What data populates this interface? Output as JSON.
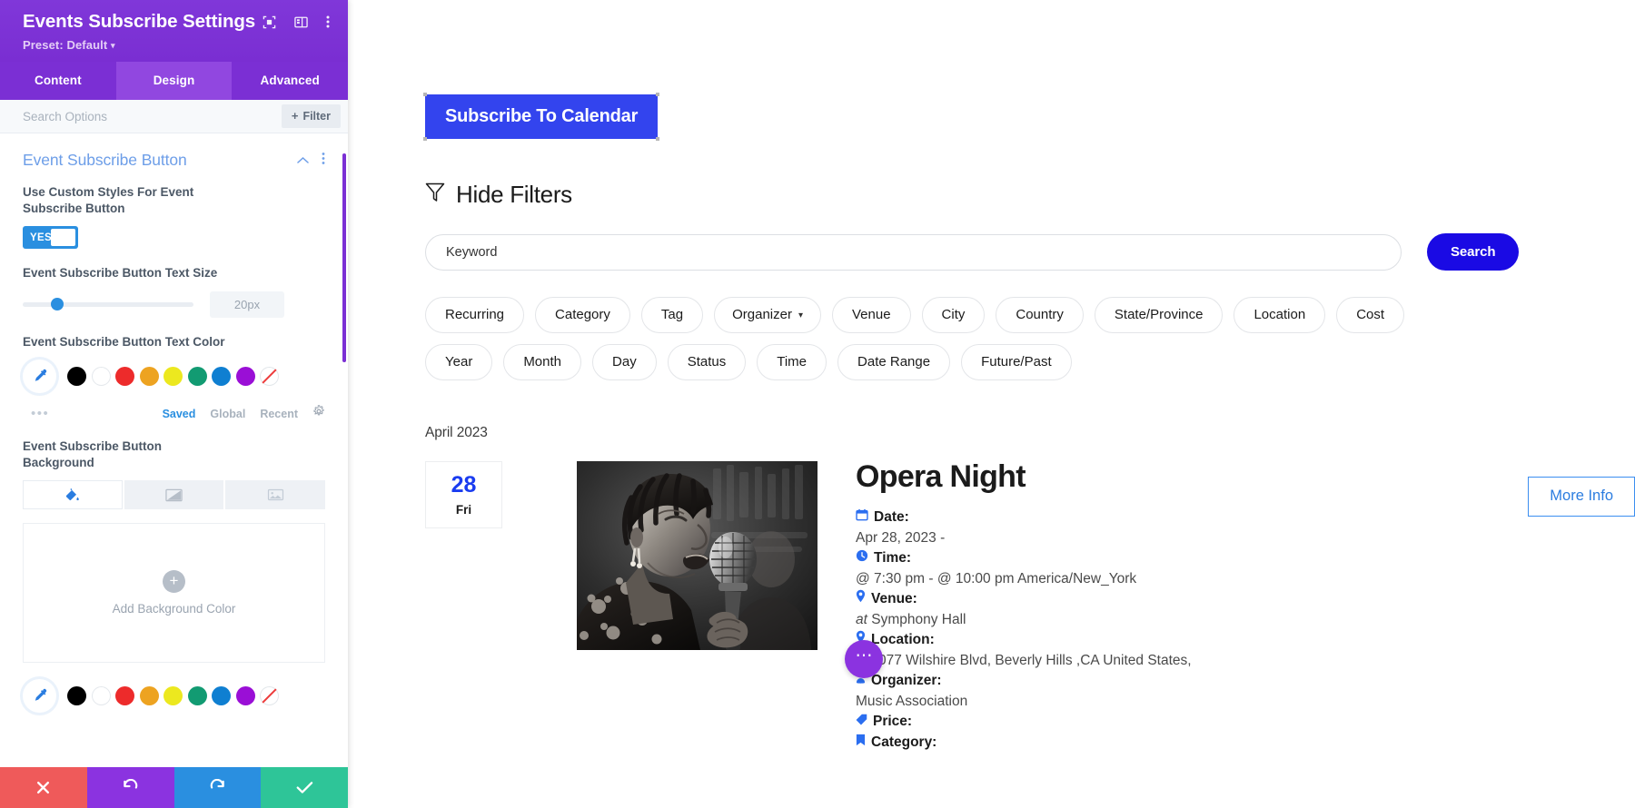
{
  "settings_panel": {
    "title": "Events Subscribe Settings",
    "preset_label": "Preset: Default",
    "header_icons": [
      "focus-target-icon",
      "panel-layout-icon",
      "vertical-dots-icon"
    ],
    "tabs": [
      {
        "label": "Content",
        "active": false
      },
      {
        "label": "Design",
        "active": true
      },
      {
        "label": "Advanced",
        "active": false
      }
    ],
    "search": {
      "placeholder": "Search Options",
      "value": ""
    },
    "filter_button": {
      "label": "Filter",
      "plus": "+"
    },
    "section": {
      "title": "Event Subscribe Button",
      "collapse_icon": "chevron-up-icon",
      "more_icon": "vertical-dots-icon"
    },
    "fields": {
      "custom_styles": {
        "label": "Use Custom Styles For Event Subscribe Button",
        "toggle_value": "YES"
      },
      "text_size": {
        "label": "Event Subscribe Button Text Size",
        "value": "20px",
        "slider_percent": 20
      },
      "text_color": {
        "label": "Event Subscribe Button Text Color",
        "picker_icon": "eyedropper-icon",
        "swatches": [
          "#000000",
          "#ffffff",
          "#ed2b2b",
          "#eda321",
          "#ece81f",
          "#129b72",
          "#0f7fd1",
          "#9a0fd6",
          "none"
        ],
        "dots": "•••",
        "links": [
          {
            "label": "Saved",
            "active": true
          },
          {
            "label": "Global",
            "active": false
          },
          {
            "label": "Recent",
            "active": false
          }
        ],
        "gear_icon": "gear-icon"
      },
      "background": {
        "label": "Event Subscribe Button Background",
        "tabs": [
          {
            "icon": "paint-bucket-icon",
            "active": true
          },
          {
            "icon": "gradient-icon",
            "active": false
          },
          {
            "icon": "image-icon",
            "active": false
          }
        ],
        "drop_label": "Add Background Color",
        "drop_plus": "+",
        "picker_icon": "eyedropper-icon",
        "swatches": [
          "#000000",
          "#ffffff",
          "#ed2b2b",
          "#eda321",
          "#ece81f",
          "#129b72",
          "#0f7fd1",
          "#9a0fd6",
          "none"
        ]
      }
    },
    "footer_buttons": [
      {
        "name": "cancel",
        "icon": "close-x-icon",
        "color": "#ef5a5a"
      },
      {
        "name": "undo",
        "icon": "undo-icon",
        "color": "#8b33e0"
      },
      {
        "name": "redo",
        "icon": "redo-icon",
        "color": "#2a8fe0"
      },
      {
        "name": "save",
        "icon": "checkmark-icon",
        "color": "#2ec598"
      }
    ]
  },
  "page": {
    "subscribe_button": {
      "label": "Subscribe To Calendar",
      "color": "#3344ee"
    },
    "hide_filters": {
      "label": "Hide Filters",
      "icon": "funnel-filter-icon"
    },
    "search": {
      "placeholder": "Keyword",
      "value": "",
      "button_label": "Search",
      "button_color": "#1a0ae4"
    },
    "filter_chips": [
      {
        "label": "Recurring"
      },
      {
        "label": "Category"
      },
      {
        "label": "Tag"
      },
      {
        "label": "Organizer",
        "has_caret": true
      },
      {
        "label": "Venue"
      },
      {
        "label": "City"
      },
      {
        "label": "Country"
      },
      {
        "label": "State/Province"
      },
      {
        "label": "Location"
      },
      {
        "label": "Cost"
      },
      {
        "label": "Year"
      },
      {
        "label": "Month"
      },
      {
        "label": "Day"
      },
      {
        "label": "Status"
      },
      {
        "label": "Time"
      },
      {
        "label": "Date Range"
      },
      {
        "label": "Future/Past"
      }
    ],
    "month_label": "April 2023",
    "event": {
      "date_number": "28",
      "date_dow": "Fri",
      "date_color": "#1a3cf0",
      "image_alt": "singer-with-microphone-photo",
      "title": "Opera Night",
      "details": [
        {
          "icon": "calendar-icon",
          "key": "Date:",
          "value": "Apr 28, 2023 -"
        },
        {
          "icon": "clock-icon",
          "key": "Time:",
          "value": "@ 7:30 pm - @ 10:00 pm America/New_York"
        },
        {
          "icon": "map-pin-icon",
          "key": "Venue:",
          "value_em": "at",
          "value": "Symphony Hall"
        },
        {
          "icon": "map-pin-icon",
          "key": "Location:",
          "value_em": "in",
          "value": "9077 Wilshire Blvd, Beverly Hills ,CA United States,"
        },
        {
          "icon": "person-icon",
          "key": "Organizer:",
          "value": "Music Association"
        },
        {
          "icon": "tag-icon",
          "key": "Price:",
          "value": ""
        },
        {
          "icon": "book-icon",
          "key": "Category:",
          "value": ""
        }
      ],
      "more_info_label": "More Info"
    },
    "fab": {
      "icon": "horizontal-dots-icon",
      "color": "#8b33e0"
    }
  }
}
